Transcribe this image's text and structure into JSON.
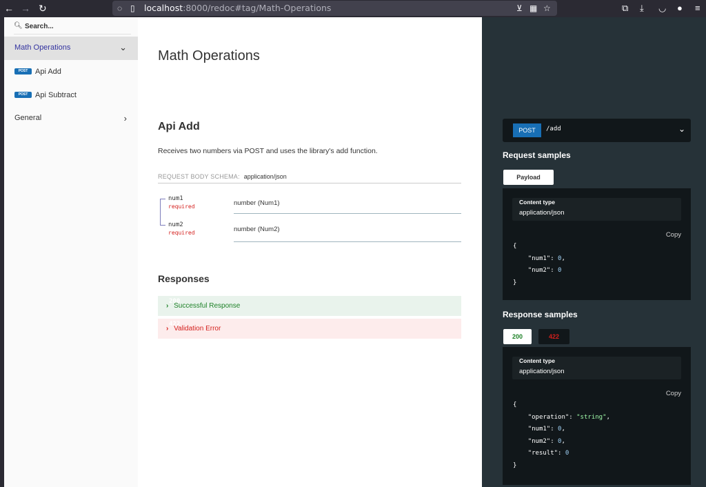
{
  "browser": {
    "url_host": "localhost",
    "url_rest": ":8000/redoc#tag/Math-Operations"
  },
  "sidebar": {
    "search_placeholder": "Search...",
    "items": [
      {
        "label": "Math Operations"
      },
      {
        "badge": "POST",
        "label": "Api Add"
      },
      {
        "badge": "POST",
        "label": "Api Subtract"
      },
      {
        "label": "General"
      }
    ]
  },
  "content": {
    "group_title": "Math Operations",
    "operation_title": "Api Add",
    "description": "Receives two numbers via POST and uses the library's add function.",
    "schema_label": "REQUEST BODY SCHEMA:",
    "schema_type": "application/json",
    "fields": [
      {
        "name": "num1",
        "required": "required",
        "type": "number (Num1)"
      },
      {
        "name": "num2",
        "required": "required",
        "type": "number (Num2)"
      }
    ],
    "responses_title": "Responses",
    "responses": [
      {
        "code": "200",
        "text": "Successful Response"
      },
      {
        "code": "422",
        "text": "Validation Error"
      }
    ]
  },
  "right_panel": {
    "method": "POST",
    "path": "/add",
    "request_title": "Request samples",
    "request_tab": "Payload",
    "content_type_label": "Content type",
    "content_type_value": "application/json",
    "copy_label": "Copy",
    "request_json": {
      "open": "{",
      "keys": [
        "\"num1\"",
        "\"num2\""
      ],
      "values": [
        "0",
        "0"
      ],
      "close": "}"
    },
    "response_title": "Response samples",
    "response_tabs": [
      "200",
      "422"
    ],
    "response_json": {
      "open": "{",
      "keys": [
        "\"operation\"",
        "\"num1\"",
        "\"num2\"",
        "\"result\""
      ],
      "values": [
        "\"string\"",
        "0",
        "0",
        "0"
      ],
      "close": "}"
    }
  }
}
